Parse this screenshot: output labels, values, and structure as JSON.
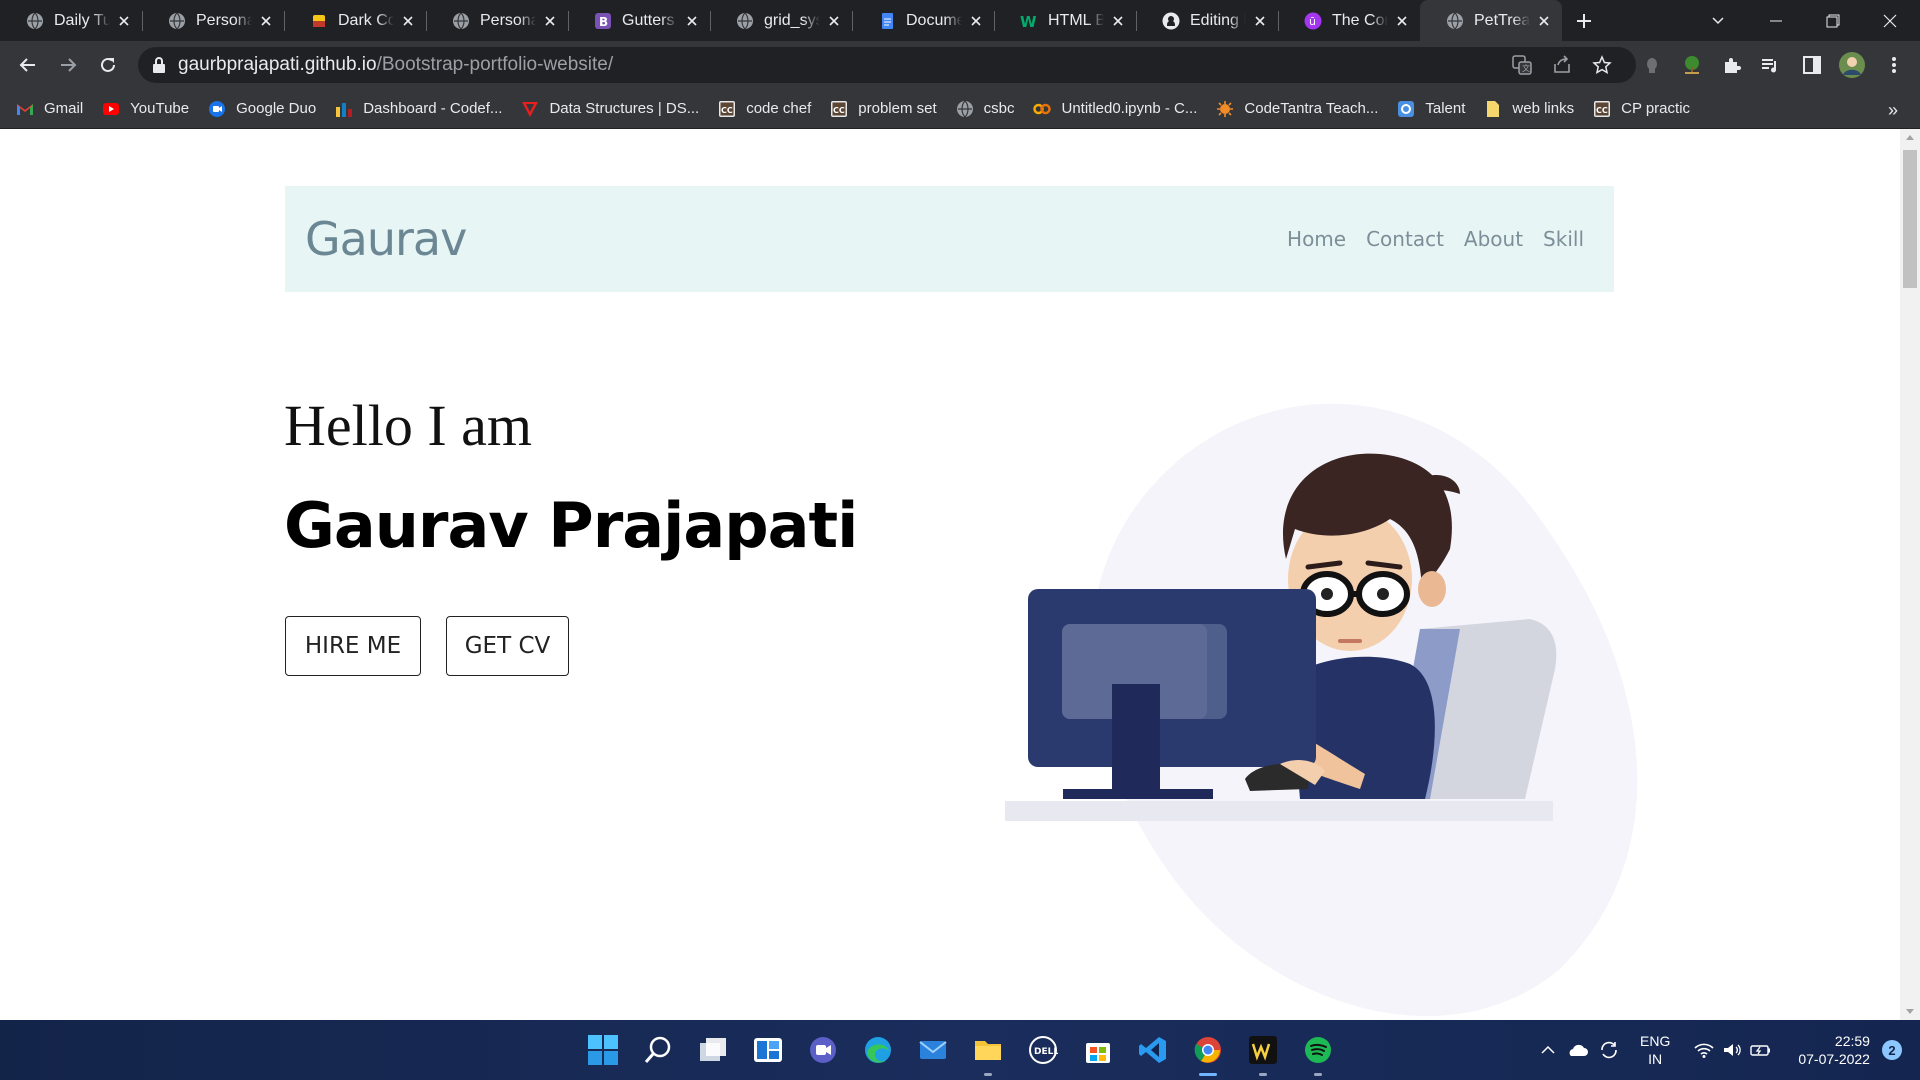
{
  "browser": {
    "tabs": [
      {
        "title": "Daily Tuit",
        "icon": "globe-icon"
      },
      {
        "title": "Personal",
        "icon": "globe-icon"
      },
      {
        "title": "Dark Colo",
        "icon": "palette-icon"
      },
      {
        "title": "Personal",
        "icon": "globe-icon"
      },
      {
        "title": "Gutters ·",
        "icon": "bootstrap-icon"
      },
      {
        "title": "grid_syste",
        "icon": "globe-icon"
      },
      {
        "title": "Documen",
        "icon": "google-docs-icon"
      },
      {
        "title": "HTML Ba",
        "icon": "w3-icon"
      },
      {
        "title": "Editing B",
        "icon": "github-icon"
      },
      {
        "title": "The Com",
        "icon": "u-icon"
      },
      {
        "title": "PetTreat",
        "icon": "globe-icon",
        "active": true
      }
    ],
    "url_host": "gaurbprajapati.github.io",
    "url_path": "/Bootstrap-portfolio-website/",
    "bookmarks": [
      {
        "label": "Gmail",
        "icon": "gmail-icon"
      },
      {
        "label": "YouTube",
        "icon": "youtube-icon"
      },
      {
        "label": "Google Duo",
        "icon": "duo-icon"
      },
      {
        "label": "Dashboard - Codef...",
        "icon": "codeforces-icon"
      },
      {
        "label": "Data Structures | DS...",
        "icon": "ds-icon"
      },
      {
        "label": "code chef",
        "icon": "cc-icon"
      },
      {
        "label": "problem set",
        "icon": "cc-icon"
      },
      {
        "label": "csbc",
        "icon": "globe-icon"
      },
      {
        "label": "Untitled0.ipynb - C...",
        "icon": "colab-icon"
      },
      {
        "label": "CodeTantra Teach...",
        "icon": "codetantra-icon"
      },
      {
        "label": "Talent",
        "icon": "talent-icon"
      },
      {
        "label": "web links",
        "icon": "folder-icon"
      },
      {
        "label": "CP practic",
        "icon": "cc-icon"
      }
    ],
    "bookmarks_more": "»"
  },
  "page": {
    "brand": "Gaurav",
    "nav": [
      "Home",
      "Contact",
      "About",
      "Skill"
    ],
    "hello": "Hello I am",
    "name": "Gaurav Prajapati",
    "hire_label": "HIRE ME",
    "cv_label": "GET CV"
  },
  "taskbar": {
    "lang": "ENG",
    "region": "IN",
    "time": "22:59",
    "date": "07-07-2022",
    "notifications": "2"
  },
  "colors": {
    "navbar_bg": "#e8f5f5",
    "brand": "#6c8794",
    "chrome_dark": "#202124",
    "chrome_toolbar": "#35363a"
  }
}
